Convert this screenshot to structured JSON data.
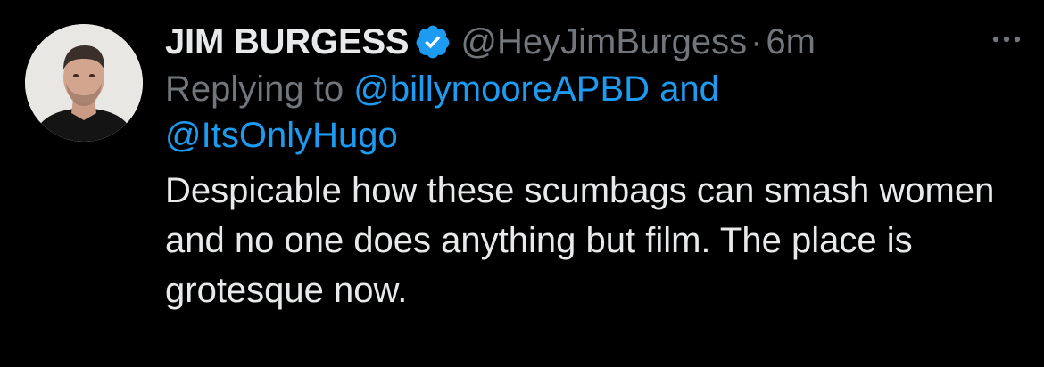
{
  "tweet": {
    "author": {
      "display_name": "JIM BURGESS",
      "verified": true,
      "handle": "@HeyJimBurgess",
      "separator": "·",
      "time": "6m"
    },
    "reply": {
      "prefix": "Replying to ",
      "mention1": "@billymooreAPBD",
      "conjunction": " and",
      "mention2": "@ItsOnlyHugo"
    },
    "text": "Despicable how these scumbags can smash women and no one does anything but film. The place is grotesque now."
  },
  "icons": {
    "avatar": "avatar",
    "verified": "verified-badge-icon",
    "more": "more-options-icon"
  },
  "colors": {
    "background": "#000000",
    "primary_text": "#e7e9ea",
    "secondary_text": "#71767b",
    "link": "#1d9bf0",
    "verified_badge": "#1d9bf0"
  }
}
